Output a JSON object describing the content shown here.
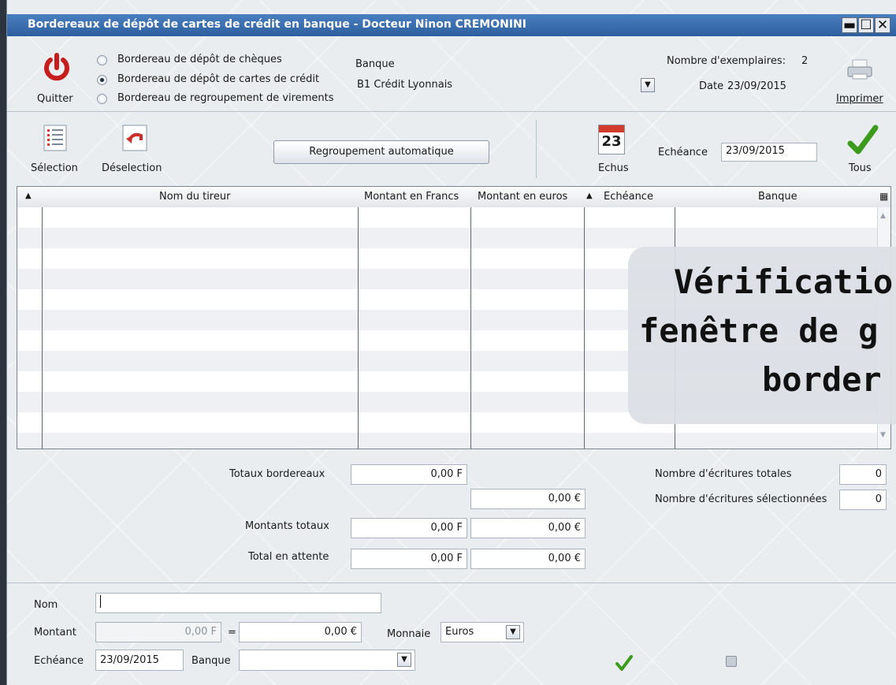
{
  "window": {
    "title": "Bordereaux de dépôt de cartes de crédit en banque - Docteur Ninon CREMONINI",
    "controls": [
      "minimize",
      "restore",
      "close"
    ]
  },
  "toolbar": {
    "quit_label": "Quitter",
    "print_label": "Imprimer",
    "radios": [
      {
        "label": "Bordereau de dépôt de chèques",
        "checked": false
      },
      {
        "label": "Bordereau de dépôt de cartes de crédit",
        "checked": true
      },
      {
        "label": "Bordereau de regroupement de virements",
        "checked": false
      }
    ],
    "bank_label": "Banque",
    "bank_value": "B1 Crédit Lyonnais",
    "copies_label": "Nombre d'exemplaires:",
    "copies_value": "2",
    "date_label": "Date",
    "date_value": "23/09/2015"
  },
  "actions": {
    "selection_label": "Sélection",
    "deselection_label": "Déselection",
    "auto_group_label": "Regroupement automatique",
    "calendar_day": "23",
    "echus_label": "Echus",
    "echeance_label": "Echéance",
    "echeance_value": "23/09/2015",
    "tous_label": "Tous"
  },
  "grid": {
    "columns": [
      "Nom du tireur",
      "Montant en Francs",
      "Montant en euros",
      "Echéance",
      "Banque"
    ],
    "rows": []
  },
  "totals": {
    "bordereaux_label": "Totaux bordereaux",
    "bordereaux_francs": "0,00 F",
    "bordereaux_euros": "0,00 €",
    "montants_label": "Montants totaux",
    "montants_francs": "0,00 F",
    "montants_euros": "0,00 €",
    "attente_label": "Total en attente",
    "attente_francs": "0,00 F",
    "attente_euros": "0,00 €",
    "ecritures_totales_label": "Nombre d'écritures totales",
    "ecritures_totales_value": "0",
    "ecritures_sel_label": "Nombre d'écritures sélectionnées",
    "ecritures_sel_value": "0"
  },
  "form": {
    "nom_label": "Nom",
    "nom_value": "",
    "montant_label": "Montant",
    "montant_francs": "0,00 F",
    "equals": "=",
    "montant_euros": "0,00 €",
    "monnaie_label": "Monnaie",
    "monnaie_value": "Euros",
    "echeance_label": "Echéance",
    "echeance_value": "23/09/2015",
    "banque_label": "Banque",
    "banque_value": ""
  },
  "overlay": {
    "line1": "Vérificatio",
    "line2": "fenêtre de g",
    "line3": "border"
  },
  "colors": {
    "title_bar": "#3a6fb0",
    "quit_red": "#c61d1d",
    "check_green": "#3c9a1c",
    "window_bg": "#eaedf0"
  }
}
